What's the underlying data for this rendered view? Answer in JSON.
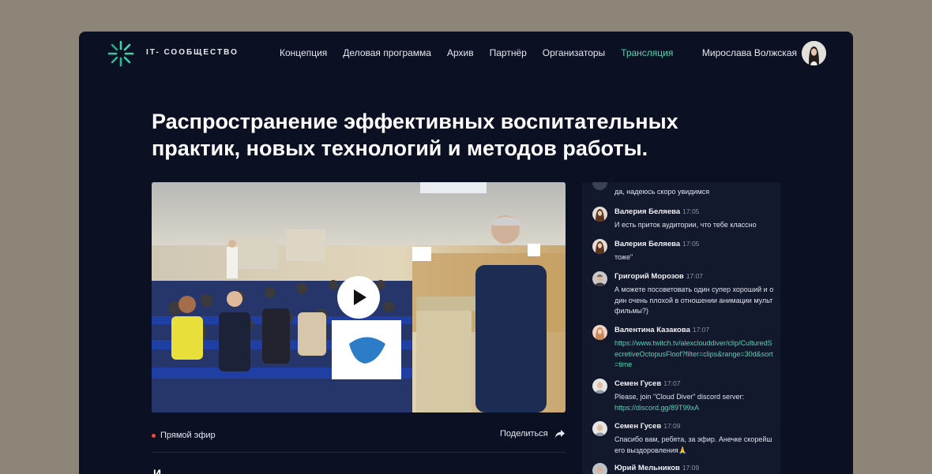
{
  "brand": {
    "logo_text": "IT- СООБЩЕСТВО"
  },
  "nav": {
    "items": [
      {
        "label": "Концепция",
        "active": false
      },
      {
        "label": "Деловая программа",
        "active": false
      },
      {
        "label": "Архив",
        "active": false
      },
      {
        "label": "Партнёр",
        "active": false
      },
      {
        "label": "Организаторы",
        "active": false
      },
      {
        "label": "Трансляция",
        "active": true
      }
    ]
  },
  "user": {
    "name": "Мирослава Волжская"
  },
  "page": {
    "title": "Распространение эффективных воспитательных практик, новых технологий и методов работы.",
    "live_label": "Прямой эфир",
    "share_label": "Поделиться",
    "next_heading_initial": "И"
  },
  "chat": {
    "first_partial_text": "да, надеюсь скоро увидимся",
    "messages": [
      {
        "author": "Валерия Беляева",
        "time": "17:05",
        "text": "И есть приток аудитории, что тебе классно",
        "is_link": false,
        "avatar": "woman-avatar"
      },
      {
        "author": "Валерия Беляева",
        "time": "17:05",
        "text": "тоже\"",
        "is_link": false,
        "avatar": "woman-avatar"
      },
      {
        "author": "Григорий Морозов",
        "time": "17:07",
        "text": "А можете посоветовать один супер хороший и один очень плохой в отношении анимации мультфильмы?)",
        "is_link": false,
        "avatar": "man-avatar"
      },
      {
        "author": "Валентина Казакова",
        "time": "17:07",
        "text": "https://www.twitch.tv/alexclouddiver/clip/CulturedSecretiveOctopusFloof?filter=clips&range=30d&sort=time",
        "is_link": true,
        "avatar": "woman-avatar"
      },
      {
        "author": "Семен Гусев",
        "time": "17:07",
        "text": "Please, join \"Cloud Diver\" discord server:",
        "link": "https://discord.gg/89T99xA",
        "is_link": false,
        "avatar": "man-avatar"
      },
      {
        "author": "Семен Гусев",
        "time": "17:09",
        "text": "Спасибо вам, ребята, за эфир. Анечке скорейшего выздоровления🙏",
        "is_link": false,
        "avatar": "man-avatar"
      },
      {
        "author": "Юрий Мельников",
        "time": "17:09",
        "text": "",
        "is_link": false,
        "avatar": "man-avatar"
      }
    ]
  },
  "colors": {
    "accent": "#4fd6b2",
    "background": "#0b1023",
    "chat_bg": "#13192d",
    "live_dot": "#ef4b4b"
  }
}
